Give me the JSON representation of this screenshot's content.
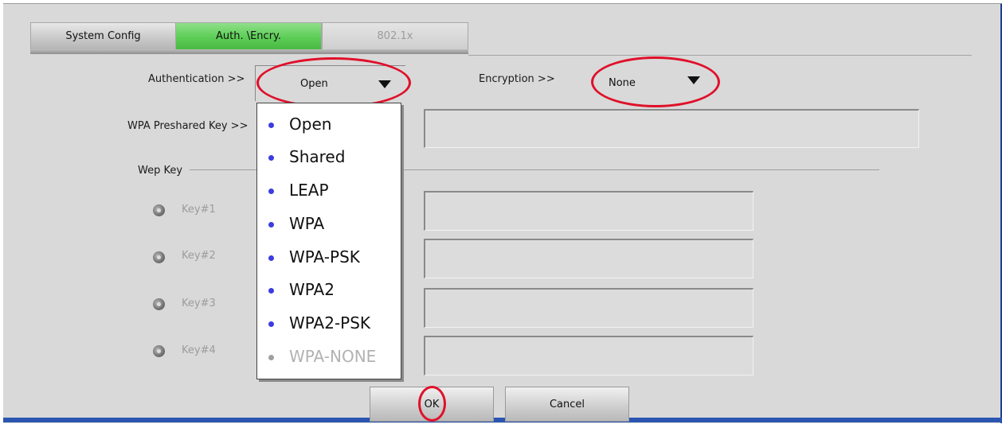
{
  "tabs": [
    {
      "label": "System Config"
    },
    {
      "label": "Auth. \\Encry."
    },
    {
      "label": "802.1x"
    }
  ],
  "authentication": {
    "label": "Authentication >>",
    "selected": "Open"
  },
  "encryption": {
    "label": "Encryption >>",
    "selected": "None"
  },
  "wpa_psk": {
    "label": "WPA Preshared Key >>",
    "value": ""
  },
  "wep": {
    "group_label": "Wep Key",
    "keys": [
      {
        "label": "Key#1",
        "value": ""
      },
      {
        "label": "Key#2",
        "value": ""
      },
      {
        "label": "Key#3",
        "value": ""
      },
      {
        "label": "Key#4",
        "value": ""
      }
    ]
  },
  "auth_options": [
    {
      "label": "Open",
      "enabled": true
    },
    {
      "label": "Shared",
      "enabled": true
    },
    {
      "label": "LEAP",
      "enabled": true
    },
    {
      "label": "WPA",
      "enabled": true
    },
    {
      "label": "WPA-PSK",
      "enabled": true
    },
    {
      "label": "WPA2",
      "enabled": true
    },
    {
      "label": "WPA2-PSK",
      "enabled": true
    },
    {
      "label": "WPA-NONE",
      "enabled": false
    }
  ],
  "buttons": {
    "ok": "OK",
    "cancel": "Cancel"
  },
  "colors": {
    "active_tab": "#5ccd56",
    "highlight_ring": "#e0102a",
    "list_bullet": "#3c3ce0"
  }
}
